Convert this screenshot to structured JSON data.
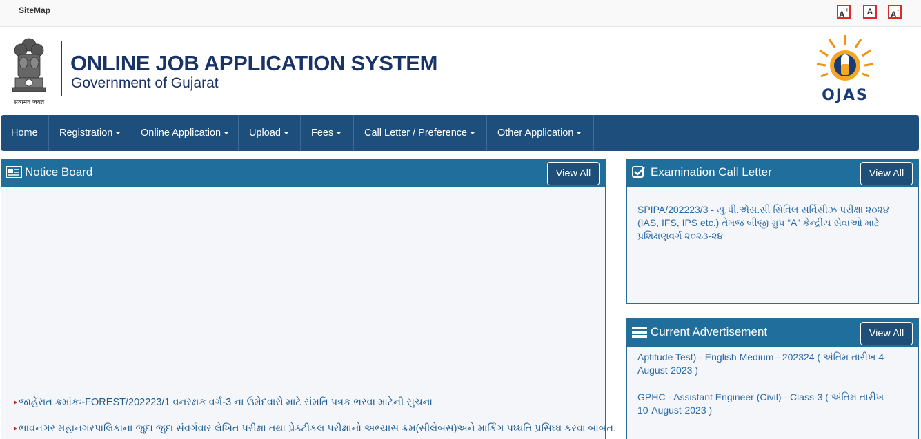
{
  "topbar": {
    "sitemap": "SiteMap",
    "font_increase": "A",
    "font_increase_sup": "+",
    "font_normal": "A",
    "font_decrease": "A",
    "font_decrease_sup": "-"
  },
  "header": {
    "emblem_caption": "सत्यमेव जयते",
    "title": "ONLINE JOB APPLICATION SYSTEM",
    "subtitle": "Government of Gujarat",
    "logo_text": "OJAS"
  },
  "nav": {
    "items": [
      "Home",
      "Registration",
      "Online Application",
      "Upload",
      "Fees",
      "Call Letter / Preference",
      "Other Application"
    ]
  },
  "notice_board": {
    "title": "Notice Board",
    "view_all": "View All",
    "items": [
      "જાહેરાત ક્રમાંકઃ-FOREST/202223/1 વનરક્ષક વર્ગ-3 ના ઉમેદવારો માટે સંમતિ પત્રક ભરવા માટેની સુચના",
      "ભાવનગર મહાનગરપાલિકાના જુદા જુદા સંવર્ગવાર લેખિત પરીક્ષા તથા પ્રેક્ટીકલ પરીક્ષાનો અભ્યાસ ક્રમ(સીલેબસ)અને માર્કિંગ પધ્ધતિ પ્રસિધ્ધ કરવા બાબત."
    ]
  },
  "exam_call_letter": {
    "title": "Examination Call Letter",
    "view_all": "View All",
    "text": "SPIPA/202223/3 - યુ.પી.એસ.સી સિવિલ સર્વિસીઝ પરીક્ષા ૨૦૨૪ (IAS, IFS, IPS etc.) તેમજ બીજી ગ્રુપ “A” કેન્દ્રીય સેવાઓ માટે પ્રશિક્ષણવર્ગ ૨૦૨૩-૨૪"
  },
  "current_advertisement": {
    "title": "Current Advertisement",
    "view_all": "View All",
    "items": [
      "Aptitude Test) - English Medium - 202324 ( અંતિમ તારીખ 4-August-2023 )",
      "GPHC - Assistant Engineer (Civil) - Class-3 ( અંતિમ તારીખ 10-August-2023 )"
    ]
  },
  "colors": {
    "nav_bg": "#1e4f7c",
    "panel_head": "#1f6e9c",
    "title_blue": "#1a3366",
    "link_blue": "#2a6aa8",
    "accent_red": "#e02a2a"
  }
}
